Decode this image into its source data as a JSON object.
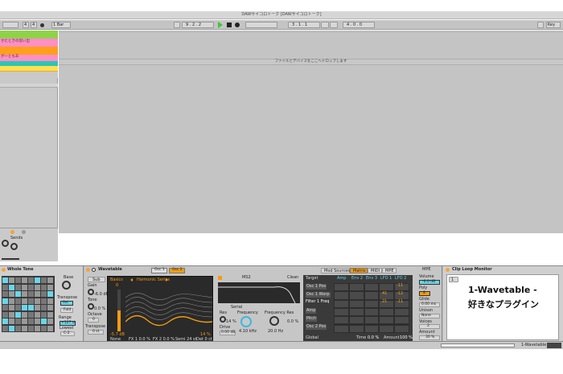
{
  "window": {
    "title": "DAWサイコロトーク  [DAWサイコロトーク]"
  },
  "transport": {
    "sig_num": "4",
    "sig_den": "4",
    "quantize": "1 Bar",
    "position": "9 .   2 .   2",
    "loop_start": "3 .   1 .   1",
    "loop_length": "4 .   0 .   0",
    "key_label": "Key"
  },
  "tracks": {
    "colors": [
      "#8fd24a",
      "#ff8fc4",
      "#ff9f1c",
      "#ff8fc4",
      "#2ec4b6",
      "#ffe14d",
      "#f3a43c"
    ],
    "labels": [
      "",
      "せたときの思い出",
      "",
      "がーともあ",
      "",
      "",
      ""
    ]
  },
  "drop_hint": "ファイルとデバイスをここへドロップします",
  "mixer": {
    "sends_label": "Sends",
    "sends": [
      "A",
      "B"
    ]
  },
  "devices": {
    "scale": {
      "title": "Whole Tone",
      "base_label": "Base",
      "transpose_label": "Transpose",
      "transpose_value": "0st",
      "fold_label": "Fold",
      "range_label": "Range",
      "range_value": "+127 st",
      "lowest_label": "Lowest",
      "lowest_value": "C-2"
    },
    "wavetable": {
      "title": "Wavetable",
      "tabs": [
        "Osc 1",
        "Osc 2"
      ],
      "sub_label": "Sub",
      "gain_label": "Gain",
      "gain_value": "-6.0 dB",
      "tone_label": "Tone",
      "tone_value": "0.0 %",
      "octave_label": "Octave",
      "octave_value": "0",
      "transpose_label": "Transpose",
      "transpose_value": "0 st",
      "category": "Basics",
      "table": "Harmonic Series",
      "osc_level_left": "0",
      "osc_db": "-5.7 dB",
      "osc_pct": "14 %",
      "fx_row": [
        "None",
        "FX 1 0.0 %",
        "FX 2 0.0 %",
        "Semi 24 st",
        "Det 0 ct"
      ],
      "filter": {
        "mode": "MS2",
        "circuit": "Clean",
        "routing": "Serial",
        "res_label": "Res",
        "res_value": "14 %",
        "freq_label": "Frequency",
        "freq_value": "4.10 kHz",
        "drive_label": "Drive",
        "drive_value": "0.00 dB",
        "freq_mod_label": "Frequency Res",
        "freq_mod_value": "20.0 Hz",
        "res_mod_value": "0.0 %"
      },
      "mod_tabs": [
        "Mod Sources",
        "Matrix",
        "MIDI",
        "MPE"
      ],
      "matrix_head": [
        "Target",
        "Amp",
        "Env 2",
        "Env 3",
        "LFO 1",
        "LFO 2"
      ],
      "matrix_rows": [
        "Osc 1 Pos",
        "Osc 1 Warp",
        "Filter 1 Freq",
        "Amp",
        "Pitch",
        "Osc 2 Pos"
      ],
      "matrix_values": {
        "r0c4": "-11",
        "r1c4": "-12",
        "r1c3": "41",
        "r2c3": "21",
        "r2c4": "-11"
      },
      "global_label": "Global",
      "time_label": "Time",
      "time_value": "0.0 %",
      "amount_label": "Amount",
      "amount_value": "100 %",
      "mpe": {
        "title": "MPE",
        "volume_label": "Volume",
        "volume_value": "-6.0 dB",
        "poly_label": "Poly",
        "poly_value": "8",
        "glide_label": "Glide",
        "glide_value": "0.00 ms",
        "unison_label": "Unison",
        "unison_value": "None",
        "voices_label": "Voices",
        "voices_value": "2",
        "amount_label": "Amount",
        "amount_value": "30 %"
      }
    },
    "clip_loop": {
      "title": "Clip Loop Monitor",
      "value": "1",
      "caption_line1": "1-Wavetable -",
      "caption_line2": "好きなプラグイン"
    }
  },
  "status": {
    "track_name": "1-Wavetable"
  }
}
